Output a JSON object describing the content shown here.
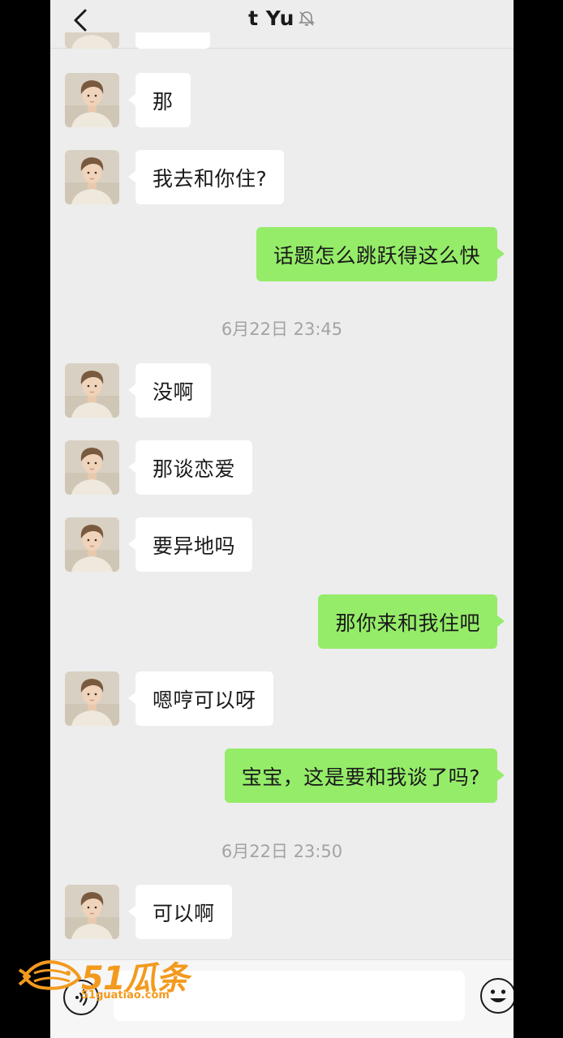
{
  "header": {
    "title": "t Yu",
    "muted_icon": "bell-muted-icon"
  },
  "messages": [
    {
      "id": "m1",
      "side": "in",
      "text": "那"
    },
    {
      "id": "m2",
      "side": "in",
      "text": "我去和你住?"
    },
    {
      "id": "m3",
      "side": "out",
      "text": "话题怎么跳跃得这么快"
    },
    {
      "id": "t1",
      "timestamp": "6月22日 23:45"
    },
    {
      "id": "m4",
      "side": "in",
      "text": "没啊"
    },
    {
      "id": "m5",
      "side": "in",
      "text": "那谈恋爱"
    },
    {
      "id": "m6",
      "side": "in",
      "text": "要异地吗"
    },
    {
      "id": "m7",
      "side": "out",
      "text": "那你来和我住吧"
    },
    {
      "id": "m8",
      "side": "in",
      "text": "嗯哼可以呀"
    },
    {
      "id": "m9",
      "side": "out",
      "text": "宝宝，这是要和我谈了吗?"
    },
    {
      "id": "t2",
      "timestamp": "6月22日 23:50"
    },
    {
      "id": "m10",
      "side": "in",
      "text": "可以啊"
    }
  ],
  "texts": {
    "m1": "那",
    "m2": "我去和你住?",
    "m3": "话题怎么跳跃得这么快",
    "t1": "6月22日 23:45",
    "m4": "没啊",
    "m5": "那谈恋爱",
    "m6": "要异地吗",
    "m7": "那你来和我住吧",
    "m8": "嗯哼可以呀",
    "m9": "宝宝，这是要和我谈了吗?",
    "t2": "6月22日 23:50",
    "m10": "可以啊"
  },
  "input": {
    "value": "",
    "placeholder": ""
  },
  "watermark": {
    "brand": "51瓜条",
    "site": "51guatiao.com"
  },
  "colors": {
    "background": "#ededed",
    "incoming_bubble": "#ffffff",
    "outgoing_bubble": "#95ec69",
    "watermark": "#f39a1e"
  }
}
